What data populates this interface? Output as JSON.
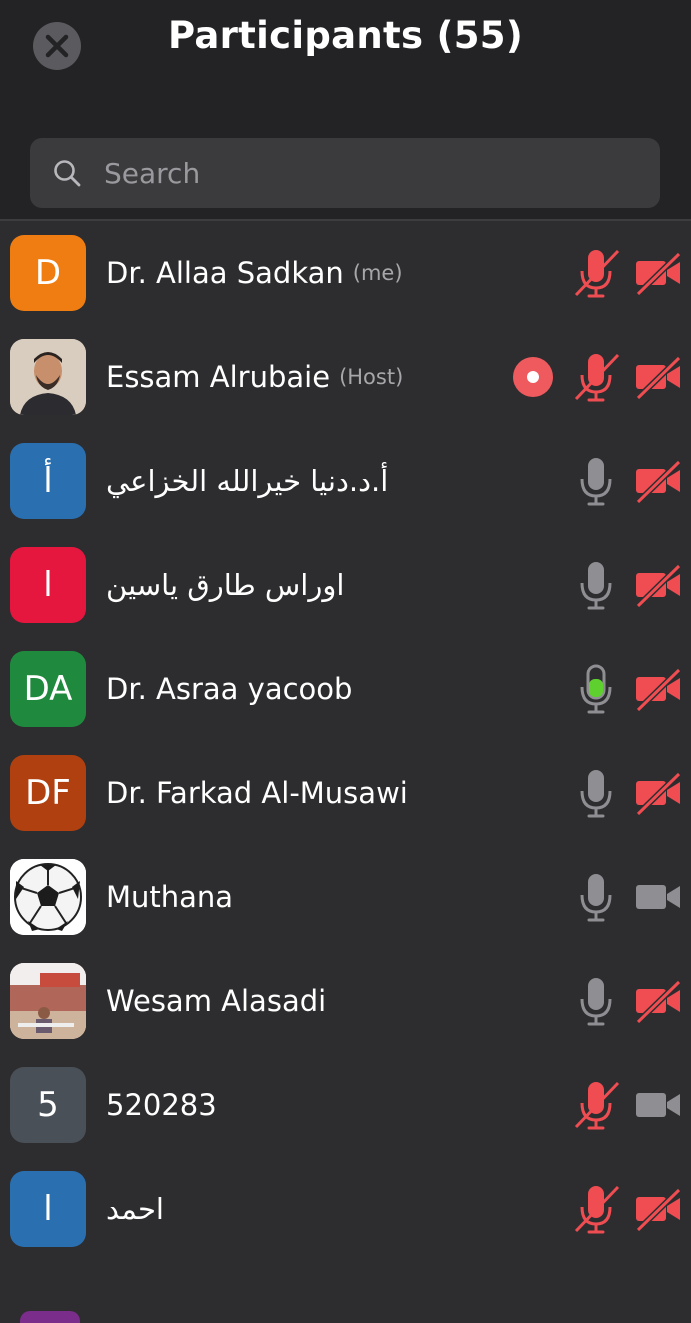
{
  "header": {
    "title": "Participants (55)",
    "close_icon": "close-icon"
  },
  "search": {
    "placeholder": "Search",
    "value": ""
  },
  "colors": {
    "muted_red": "#ef4d52",
    "mic_on_gray": "#8e8e93",
    "speaking_green": "#5fd12e",
    "record_red": "#ef5a5e"
  },
  "participants": [
    {
      "name": "Dr. Allaa Sadkan",
      "tag": "(me)",
      "avatar_text": "D",
      "avatar_color": "#f07d12",
      "recording": false,
      "mic": "muted",
      "video": "off"
    },
    {
      "name": "Essam Alrubaie",
      "tag": "(Host)",
      "avatar_text": "",
      "avatar_color": "#c9b9a6",
      "recording": true,
      "mic": "muted",
      "video": "off"
    },
    {
      "name": "أ.د.دنيا خيرالله الخزاعي",
      "tag": "",
      "avatar_text": "أ",
      "avatar_color": "#2a6fb0",
      "recording": false,
      "mic": "on",
      "video": "off"
    },
    {
      "name": "اوراس طارق ياسين",
      "tag": "",
      "avatar_text": "ا",
      "avatar_color": "#e5173f",
      "recording": false,
      "mic": "on",
      "video": "off"
    },
    {
      "name": "Dr. Asraa yacoob",
      "tag": "",
      "avatar_text": "DA",
      "avatar_color": "#1f8a3d",
      "recording": false,
      "mic": "speaking",
      "video": "off"
    },
    {
      "name": "Dr. Farkad Al-Musawi",
      "tag": "",
      "avatar_text": "DF",
      "avatar_color": "#b0400f",
      "recording": false,
      "mic": "on",
      "video": "off"
    },
    {
      "name": "Muthana",
      "tag": "",
      "avatar_text": "",
      "avatar_color": "#ffffff",
      "recording": false,
      "mic": "on",
      "video": "on"
    },
    {
      "name": "Wesam Alasadi",
      "tag": "",
      "avatar_text": "",
      "avatar_color": "#b78a78",
      "recording": false,
      "mic": "on",
      "video": "off"
    },
    {
      "name": "520283",
      "tag": "",
      "avatar_text": "5",
      "avatar_color": "#4a5058",
      "recording": false,
      "mic": "muted",
      "video": "on"
    },
    {
      "name": "احمد",
      "tag": "",
      "avatar_text": "ا",
      "avatar_color": "#2a6fb0",
      "recording": false,
      "mic": "muted",
      "video": "off"
    }
  ]
}
